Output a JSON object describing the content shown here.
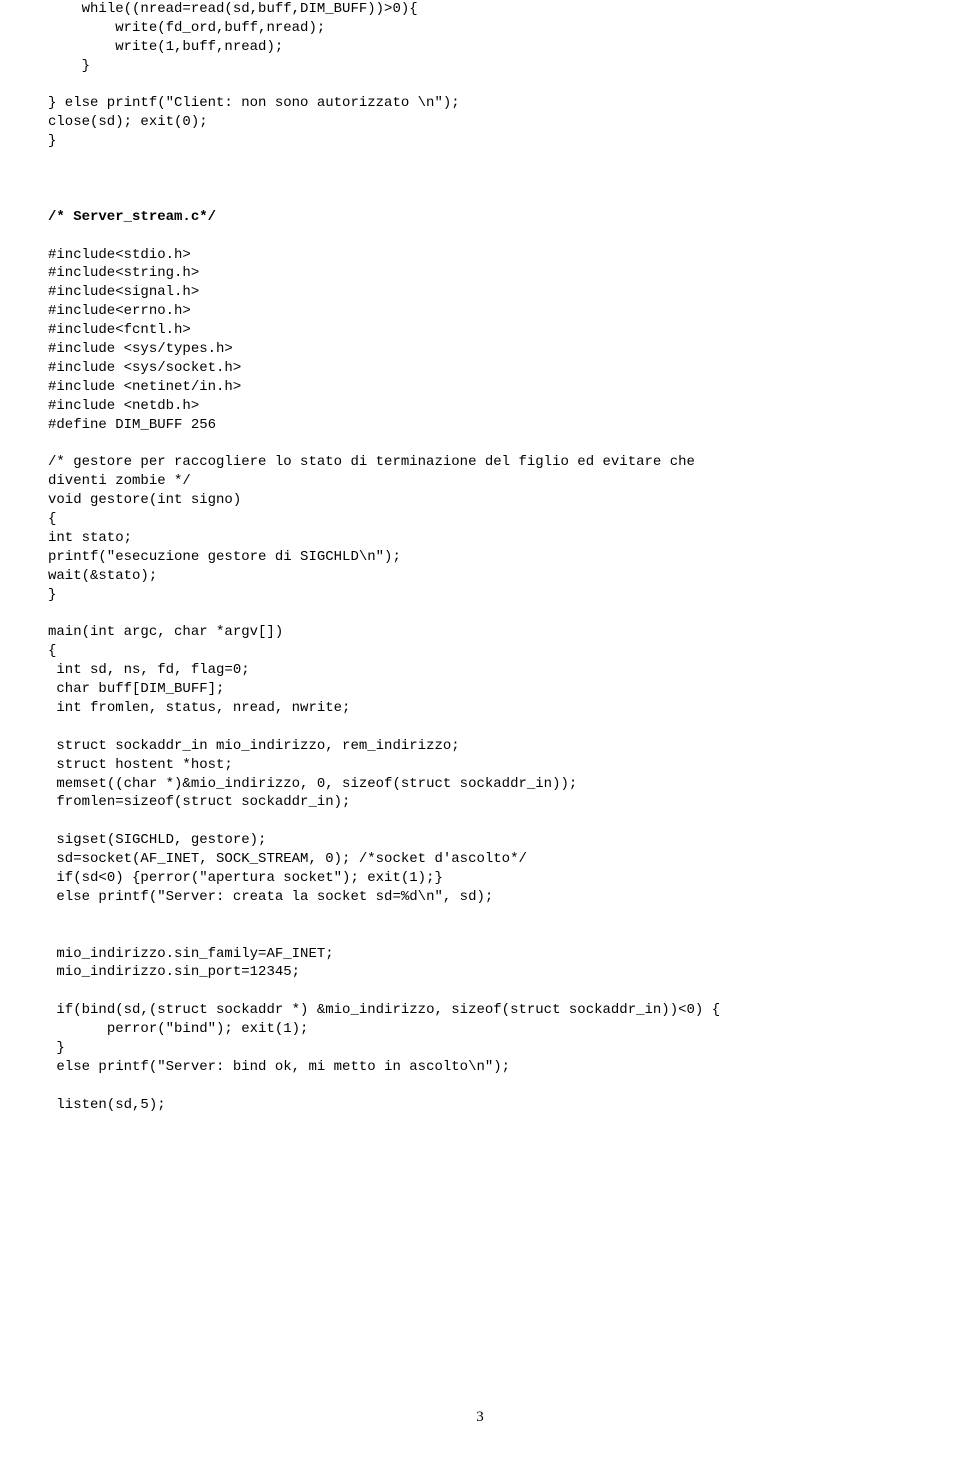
{
  "code_top": "    while((nread=read(sd,buff,DIM_BUFF))>0){\n        write(fd_ord,buff,nread);\n        write(1,buff,nread);\n    }\n\n} else printf(\"Client: non sono autorizzato \\n\");\nclose(sd); exit(0);\n}\n\n\n\n",
  "heading": "/* Server_stream.c*/",
  "code_bottom": "\n#include<stdio.h>\n#include<string.h>\n#include<signal.h>\n#include<errno.h>\n#include<fcntl.h>\n#include <sys/types.h>\n#include <sys/socket.h>\n#include <netinet/in.h>\n#include <netdb.h>\n#define DIM_BUFF 256\n\n/* gestore per raccogliere lo stato di terminazione del figlio ed evitare che\ndiventi zombie */\nvoid gestore(int signo)\n{\nint stato;\nprintf(\"esecuzione gestore di SIGCHLD\\n\");\nwait(&stato);\n}\n\nmain(int argc, char *argv[])\n{\n int sd, ns, fd, flag=0;\n char buff[DIM_BUFF];\n int fromlen, status, nread, nwrite;\n\n struct sockaddr_in mio_indirizzo, rem_indirizzo;\n struct hostent *host;\n memset((char *)&mio_indirizzo, 0, sizeof(struct sockaddr_in));\n fromlen=sizeof(struct sockaddr_in);\n\n sigset(SIGCHLD, gestore);\n sd=socket(AF_INET, SOCK_STREAM, 0); /*socket d'ascolto*/\n if(sd<0) {perror(\"apertura socket\"); exit(1);}\n else printf(\"Server: creata la socket sd=%d\\n\", sd);\n\n\n mio_indirizzo.sin_family=AF_INET;\n mio_indirizzo.sin_port=12345;\n\n if(bind(sd,(struct sockaddr *) &mio_indirizzo, sizeof(struct sockaddr_in))<0) {\n       perror(\"bind\"); exit(1);\n }\n else printf(\"Server: bind ok, mi metto in ascolto\\n\");\n\n listen(sd,5);",
  "page_number": "3"
}
